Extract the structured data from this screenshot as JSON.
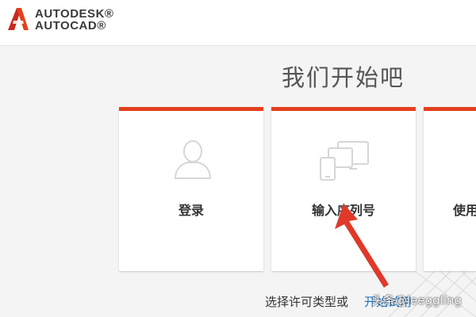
{
  "header": {
    "brand_line1": "AUTODESK®",
    "brand_line2": "AUTOCAD®",
    "logo_icon": "autocad-a-logo"
  },
  "main": {
    "title": "我们开始吧",
    "cards": [
      {
        "label": "登录",
        "icon": "user-icon"
      },
      {
        "label": "输入序列号",
        "icon": "devices-icon"
      },
      {
        "label": "使用"
      }
    ],
    "footer_text": "选择许可类型或",
    "footer_link": "开始试用"
  },
  "watermark": "头条@leeggling",
  "colors": {
    "accent": "#e4401e",
    "arrow": "#e0392a",
    "link": "#1a73c8"
  }
}
